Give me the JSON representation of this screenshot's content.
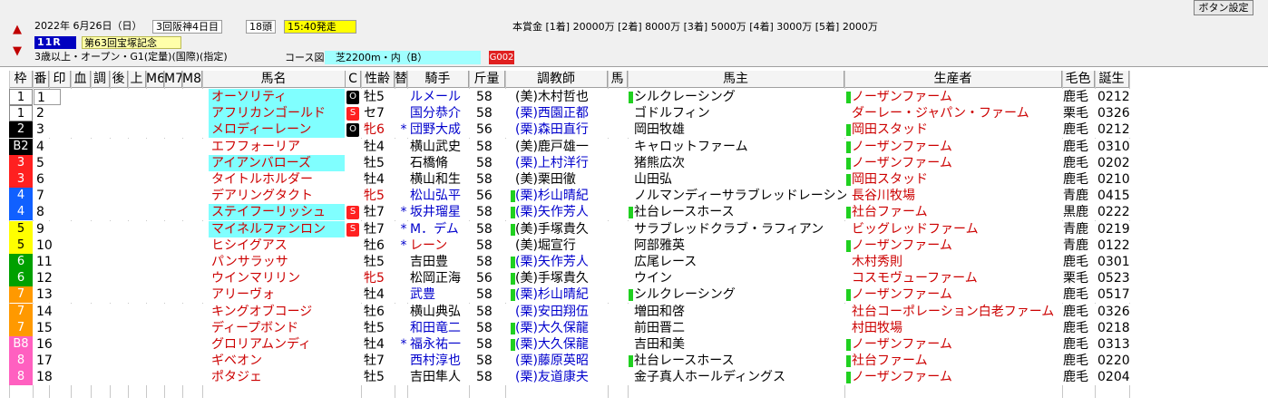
{
  "header": {
    "date": "2022年 6月26日（日）",
    "meeting": "3回阪神4日目",
    "heads": "18頭",
    "start": "15:40発走",
    "prizes": "本賞金 [1着] 20000万 [2着] 8000万 [3着] 5000万 [4着] 3000万 [5着] 2000万",
    "race_num": "11R",
    "race_name": "第63回宝塚記念",
    "conditions": "3歳以上・オープン・G1(定量)(国際)(指定)",
    "course_label": "コース図",
    "course": "芝2200m・内（B）",
    "code": "G002",
    "settings_button": "ボタン設定"
  },
  "columns": [
    "枠",
    "番",
    "印",
    "血",
    "調",
    "後",
    "上",
    "M6",
    "M7",
    "M8",
    "馬名",
    "C",
    "性齢",
    "替",
    "騎手",
    "斤量",
    "調教師",
    "馬",
    "馬主",
    "生産者",
    "毛色",
    "誕生"
  ],
  "colors": {
    "header_bg": "#f0f0f0",
    "highlight": "#80ffff",
    "start_bg": "#ffff00",
    "race_bg": "#0000c0",
    "green": "#20d020",
    "red_text": "#cc0000",
    "blue_text": "#0000cc"
  },
  "rows": [
    {
      "waku": "1",
      "uma": "1",
      "name": "オーソリティ",
      "hl": true,
      "badge": "O",
      "sex": "牡5",
      "mark": "",
      "jockey": "ルメール",
      "jc": "blue",
      "weight": "58",
      "trainer": "(美)木村哲也",
      "tc": "black",
      "owner": "シルクレーシング",
      "og": true,
      "breeder": "ノーザンファーム",
      "bg": true,
      "bc": "red",
      "coat": "鹿毛",
      "birth": "0212"
    },
    {
      "waku": "1",
      "uma": "2",
      "name": "アフリカンゴールド",
      "hl": true,
      "badge": "S",
      "sex": "セ7",
      "mark": "",
      "jockey": "国分恭介",
      "jc": "blue",
      "weight": "58",
      "trainer": "(栗)西園正都",
      "tc": "blue",
      "owner": "ゴドルフィン",
      "og": false,
      "breeder": "ダーレー・ジャパン・ファーム",
      "bg": false,
      "bc": "red",
      "coat": "栗毛",
      "birth": "0326"
    },
    {
      "waku": "2",
      "uma": "3",
      "name": "メロディーレーン",
      "hl": true,
      "badge": "O",
      "sex": "牝6",
      "mark": "*",
      "jockey": "団野大成",
      "jc": "blue",
      "weight": "56",
      "trainer": "(栗)森田直行",
      "tc": "blue",
      "owner": "岡田牧雄",
      "og": false,
      "breeder": "岡田スタッド",
      "bg": true,
      "bc": "red",
      "coat": "鹿毛",
      "birth": "0212"
    },
    {
      "waku": "B2",
      "uma": "4",
      "name": "エフフォーリア",
      "hl": false,
      "badge": "",
      "sex": "牡4",
      "mark": "",
      "jockey": "横山武史",
      "jc": "black",
      "weight": "58",
      "trainer": "(美)鹿戸雄一",
      "tc": "black",
      "owner": "キャロットファーム",
      "og": false,
      "breeder": "ノーザンファーム",
      "bg": true,
      "bc": "red",
      "coat": "鹿毛",
      "birth": "0310"
    },
    {
      "waku": "3",
      "uma": "5",
      "name": "アイアンバローズ",
      "hl": true,
      "badge": "",
      "sex": "牡5",
      "mark": "",
      "jockey": "石橋脩",
      "jc": "black",
      "weight": "58",
      "trainer": "(栗)上村洋行",
      "tc": "blue",
      "owner": "猪熊広次",
      "og": false,
      "breeder": "ノーザンファーム",
      "bg": true,
      "bc": "red",
      "coat": "鹿毛",
      "birth": "0202"
    },
    {
      "waku": "3",
      "uma": "6",
      "name": "タイトルホルダー",
      "hl": false,
      "badge": "",
      "sex": "牡4",
      "mark": "",
      "jockey": "横山和生",
      "jc": "black",
      "weight": "58",
      "trainer": "(美)栗田徹",
      "tc": "black",
      "owner": "山田弘",
      "og": false,
      "breeder": "岡田スタッド",
      "bg": true,
      "bc": "red",
      "coat": "鹿毛",
      "birth": "0210"
    },
    {
      "waku": "4",
      "uma": "7",
      "name": "デアリングタクト",
      "hl": false,
      "badge": "",
      "sex": "牝5",
      "mark": "",
      "jockey": "松山弘平",
      "jc": "blue",
      "weight": "56",
      "trainer": "(栗)杉山晴紀",
      "tc": "blue",
      "tg": true,
      "owner": "ノルマンディーサラブレッドレーシング",
      "og": false,
      "breeder": "長谷川牧場",
      "bg": false,
      "bc": "red",
      "coat": "青鹿",
      "birth": "0415"
    },
    {
      "waku": "4",
      "uma": "8",
      "name": "ステイフーリッシュ",
      "hl": true,
      "badge": "S",
      "sex": "牡7",
      "mark": "*",
      "jockey": "坂井瑠星",
      "jc": "blue",
      "weight": "58",
      "trainer": "(栗)矢作芳人",
      "tc": "blue",
      "tg": true,
      "owner": "社台レースホース",
      "og": true,
      "breeder": "社台ファーム",
      "bg": true,
      "bc": "red",
      "coat": "黒鹿",
      "birth": "0222"
    },
    {
      "waku": "5",
      "uma": "9",
      "name": "マイネルファンロン",
      "hl": true,
      "badge": "S",
      "sex": "牡7",
      "mark": "*",
      "jockey": "M．デム",
      "jc": "blue",
      "weight": "58",
      "trainer": "(美)手塚貴久",
      "tc": "black",
      "tg": true,
      "owner": "サラブレッドクラブ・ラフィアン",
      "og": false,
      "breeder": "ビッグレッドファーム",
      "bg": false,
      "bc": "red",
      "coat": "青鹿",
      "birth": "0219"
    },
    {
      "waku": "5",
      "uma": "10",
      "name": "ヒシイグアス",
      "hl": false,
      "badge": "",
      "sex": "牡6",
      "mark": "*",
      "jockey": "レーン",
      "jc": "red",
      "weight": "58",
      "trainer": "(美)堀宣行",
      "tc": "black",
      "owner": "阿部雅英",
      "og": false,
      "breeder": "ノーザンファーム",
      "bg": true,
      "bc": "red",
      "coat": "青鹿",
      "birth": "0122"
    },
    {
      "waku": "6",
      "uma": "11",
      "name": "パンサラッサ",
      "hl": false,
      "badge": "",
      "sex": "牡5",
      "mark": "",
      "jockey": "吉田豊",
      "jc": "black",
      "weight": "58",
      "trainer": "(栗)矢作芳人",
      "tc": "blue",
      "tg": true,
      "owner": "広尾レース",
      "og": false,
      "breeder": "木村秀則",
      "bg": false,
      "bc": "red",
      "coat": "鹿毛",
      "birth": "0301"
    },
    {
      "waku": "6",
      "uma": "12",
      "name": "ウインマリリン",
      "hl": false,
      "badge": "",
      "sex": "牝5",
      "mark": "",
      "jockey": "松岡正海",
      "jc": "black",
      "weight": "56",
      "trainer": "(美)手塚貴久",
      "tc": "black",
      "tg": true,
      "owner": "ウイン",
      "og": false,
      "breeder": "コスモヴューファーム",
      "bg": false,
      "bc": "red",
      "coat": "栗毛",
      "birth": "0523"
    },
    {
      "waku": "7",
      "uma": "13",
      "name": "アリーヴォ",
      "hl": false,
      "badge": "",
      "sex": "牡4",
      "mark": "",
      "jockey": "武豊",
      "jc": "blue",
      "weight": "58",
      "trainer": "(栗)杉山晴紀",
      "tc": "blue",
      "tg": true,
      "owner": "シルクレーシング",
      "og": true,
      "breeder": "ノーザンファーム",
      "bg": true,
      "bc": "red",
      "coat": "鹿毛",
      "birth": "0517"
    },
    {
      "waku": "7",
      "uma": "14",
      "name": "キングオブコージ",
      "hl": false,
      "badge": "",
      "sex": "牡6",
      "mark": "",
      "jockey": "横山典弘",
      "jc": "black",
      "weight": "58",
      "trainer": "(栗)安田翔伍",
      "tc": "blue",
      "owner": "増田和啓",
      "og": false,
      "breeder": "社台コーポレーション白老ファーム",
      "bg": false,
      "bc": "red",
      "coat": "鹿毛",
      "birth": "0326"
    },
    {
      "waku": "7",
      "uma": "15",
      "name": "ディープボンド",
      "hl": false,
      "badge": "",
      "sex": "牡5",
      "mark": "",
      "jockey": "和田竜二",
      "jc": "blue",
      "weight": "58",
      "trainer": "(栗)大久保龍",
      "tc": "blue",
      "tg": true,
      "owner": "前田晋二",
      "og": false,
      "breeder": "村田牧場",
      "bg": false,
      "bc": "red",
      "coat": "鹿毛",
      "birth": "0218"
    },
    {
      "waku": "B8",
      "uma": "16",
      "name": "グロリアムンディ",
      "hl": false,
      "badge": "",
      "sex": "牡4",
      "mark": "*",
      "jockey": "福永祐一",
      "jc": "blue",
      "weight": "58",
      "trainer": "(栗)大久保龍",
      "tc": "blue",
      "tg": true,
      "owner": "吉田和美",
      "og": false,
      "breeder": "ノーザンファーム",
      "bg": true,
      "bc": "red",
      "coat": "鹿毛",
      "birth": "0313"
    },
    {
      "waku": "8",
      "uma": "17",
      "name": "ギベオン",
      "hl": false,
      "badge": "",
      "sex": "牡7",
      "mark": "",
      "jockey": "西村淳也",
      "jc": "blue",
      "weight": "58",
      "trainer": "(栗)藤原英昭",
      "tc": "blue",
      "owner": "社台レースホース",
      "og": true,
      "breeder": "社台ファーム",
      "bg": true,
      "bc": "red",
      "coat": "鹿毛",
      "birth": "0220"
    },
    {
      "waku": "8",
      "uma": "18",
      "name": "ポタジェ",
      "hl": false,
      "badge": "",
      "sex": "牡5",
      "mark": "",
      "jockey": "吉田隼人",
      "jc": "black",
      "weight": "58",
      "trainer": "(栗)友道康夫",
      "tc": "blue",
      "owner": "金子真人ホールディングス",
      "og": false,
      "breeder": "ノーザンファーム",
      "bg": true,
      "bc": "red",
      "coat": "鹿毛",
      "birth": "0204"
    }
  ]
}
